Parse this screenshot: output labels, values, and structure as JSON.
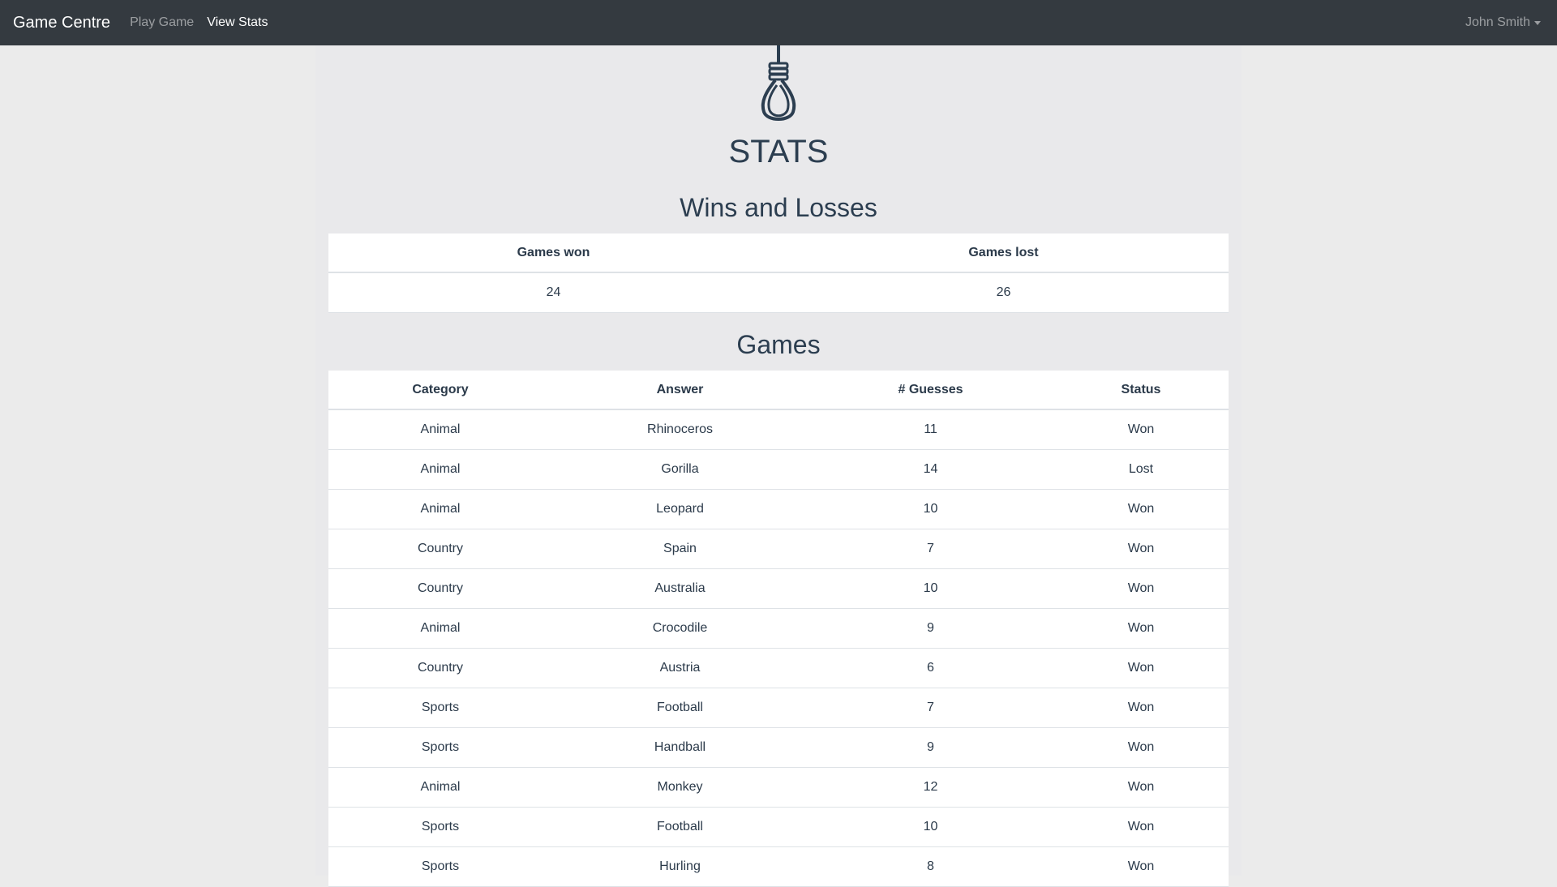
{
  "navbar": {
    "brand": "Game Centre",
    "links": [
      {
        "label": "Play Game",
        "active": false
      },
      {
        "label": "View Stats",
        "active": true
      }
    ],
    "user": "John Smith"
  },
  "logo_icon": "noose-icon",
  "page_title": "STATS",
  "summary": {
    "title": "Wins and Losses",
    "headers": [
      "Games won",
      "Games lost"
    ],
    "values": [
      "24",
      "26"
    ]
  },
  "games": {
    "title": "Games",
    "headers": [
      "Category",
      "Answer",
      "# Guesses",
      "Status"
    ],
    "rows": [
      [
        "Animal",
        "Rhinoceros",
        "11",
        "Won"
      ],
      [
        "Animal",
        "Gorilla",
        "14",
        "Lost"
      ],
      [
        "Animal",
        "Leopard",
        "10",
        "Won"
      ],
      [
        "Country",
        "Spain",
        "7",
        "Won"
      ],
      [
        "Country",
        "Australia",
        "10",
        "Won"
      ],
      [
        "Animal",
        "Crocodile",
        "9",
        "Won"
      ],
      [
        "Country",
        "Austria",
        "6",
        "Won"
      ],
      [
        "Sports",
        "Football",
        "7",
        "Won"
      ],
      [
        "Sports",
        "Handball",
        "9",
        "Won"
      ],
      [
        "Animal",
        "Monkey",
        "12",
        "Won"
      ],
      [
        "Sports",
        "Football",
        "10",
        "Won"
      ],
      [
        "Sports",
        "Hurling",
        "8",
        "Won"
      ]
    ]
  },
  "colors": {
    "navbar_bg": "#343a40",
    "page_bg": "#ebebeb",
    "container_bg": "#e9e9eb",
    "text": "#2b3a4a"
  }
}
